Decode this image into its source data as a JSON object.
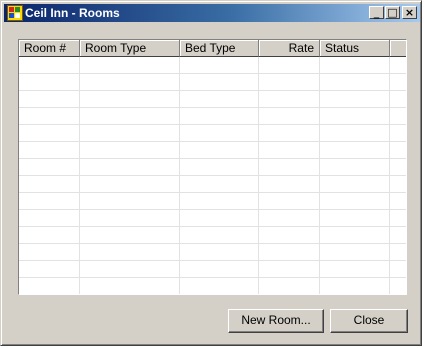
{
  "window": {
    "title": "Ceil Inn - Rooms",
    "controls": {
      "minimize": "_",
      "maximize": "□",
      "close": "×"
    }
  },
  "grid": {
    "columns": [
      "Room #",
      "Room Type",
      "Bed Type",
      "Rate",
      "Status"
    ],
    "rows": []
  },
  "buttons": {
    "new_room": "New Room...",
    "close": "Close"
  }
}
